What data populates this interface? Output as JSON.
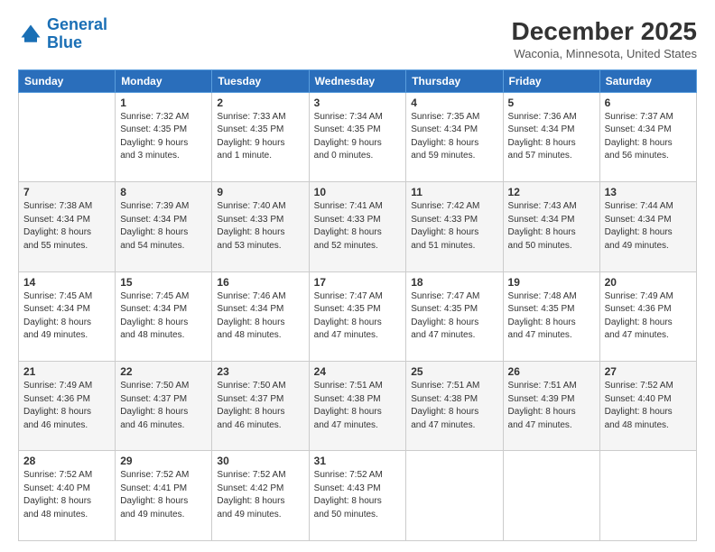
{
  "logo": {
    "line1": "General",
    "line2": "Blue"
  },
  "header": {
    "title": "December 2025",
    "subtitle": "Waconia, Minnesota, United States"
  },
  "calendar": {
    "days": [
      "Sunday",
      "Monday",
      "Tuesday",
      "Wednesday",
      "Thursday",
      "Friday",
      "Saturday"
    ],
    "weeks": [
      [
        {
          "day": "",
          "info": ""
        },
        {
          "day": "1",
          "info": "Sunrise: 7:32 AM\nSunset: 4:35 PM\nDaylight: 9 hours\nand 3 minutes."
        },
        {
          "day": "2",
          "info": "Sunrise: 7:33 AM\nSunset: 4:35 PM\nDaylight: 9 hours\nand 1 minute."
        },
        {
          "day": "3",
          "info": "Sunrise: 7:34 AM\nSunset: 4:35 PM\nDaylight: 9 hours\nand 0 minutes."
        },
        {
          "day": "4",
          "info": "Sunrise: 7:35 AM\nSunset: 4:34 PM\nDaylight: 8 hours\nand 59 minutes."
        },
        {
          "day": "5",
          "info": "Sunrise: 7:36 AM\nSunset: 4:34 PM\nDaylight: 8 hours\nand 57 minutes."
        },
        {
          "day": "6",
          "info": "Sunrise: 7:37 AM\nSunset: 4:34 PM\nDaylight: 8 hours\nand 56 minutes."
        }
      ],
      [
        {
          "day": "7",
          "info": "Sunrise: 7:38 AM\nSunset: 4:34 PM\nDaylight: 8 hours\nand 55 minutes."
        },
        {
          "day": "8",
          "info": "Sunrise: 7:39 AM\nSunset: 4:34 PM\nDaylight: 8 hours\nand 54 minutes."
        },
        {
          "day": "9",
          "info": "Sunrise: 7:40 AM\nSunset: 4:33 PM\nDaylight: 8 hours\nand 53 minutes."
        },
        {
          "day": "10",
          "info": "Sunrise: 7:41 AM\nSunset: 4:33 PM\nDaylight: 8 hours\nand 52 minutes."
        },
        {
          "day": "11",
          "info": "Sunrise: 7:42 AM\nSunset: 4:33 PM\nDaylight: 8 hours\nand 51 minutes."
        },
        {
          "day": "12",
          "info": "Sunrise: 7:43 AM\nSunset: 4:34 PM\nDaylight: 8 hours\nand 50 minutes."
        },
        {
          "day": "13",
          "info": "Sunrise: 7:44 AM\nSunset: 4:34 PM\nDaylight: 8 hours\nand 49 minutes."
        }
      ],
      [
        {
          "day": "14",
          "info": "Sunrise: 7:45 AM\nSunset: 4:34 PM\nDaylight: 8 hours\nand 49 minutes."
        },
        {
          "day": "15",
          "info": "Sunrise: 7:45 AM\nSunset: 4:34 PM\nDaylight: 8 hours\nand 48 minutes."
        },
        {
          "day": "16",
          "info": "Sunrise: 7:46 AM\nSunset: 4:34 PM\nDaylight: 8 hours\nand 48 minutes."
        },
        {
          "day": "17",
          "info": "Sunrise: 7:47 AM\nSunset: 4:35 PM\nDaylight: 8 hours\nand 47 minutes."
        },
        {
          "day": "18",
          "info": "Sunrise: 7:47 AM\nSunset: 4:35 PM\nDaylight: 8 hours\nand 47 minutes."
        },
        {
          "day": "19",
          "info": "Sunrise: 7:48 AM\nSunset: 4:35 PM\nDaylight: 8 hours\nand 47 minutes."
        },
        {
          "day": "20",
          "info": "Sunrise: 7:49 AM\nSunset: 4:36 PM\nDaylight: 8 hours\nand 47 minutes."
        }
      ],
      [
        {
          "day": "21",
          "info": "Sunrise: 7:49 AM\nSunset: 4:36 PM\nDaylight: 8 hours\nand 46 minutes."
        },
        {
          "day": "22",
          "info": "Sunrise: 7:50 AM\nSunset: 4:37 PM\nDaylight: 8 hours\nand 46 minutes."
        },
        {
          "day": "23",
          "info": "Sunrise: 7:50 AM\nSunset: 4:37 PM\nDaylight: 8 hours\nand 46 minutes."
        },
        {
          "day": "24",
          "info": "Sunrise: 7:51 AM\nSunset: 4:38 PM\nDaylight: 8 hours\nand 47 minutes."
        },
        {
          "day": "25",
          "info": "Sunrise: 7:51 AM\nSunset: 4:38 PM\nDaylight: 8 hours\nand 47 minutes."
        },
        {
          "day": "26",
          "info": "Sunrise: 7:51 AM\nSunset: 4:39 PM\nDaylight: 8 hours\nand 47 minutes."
        },
        {
          "day": "27",
          "info": "Sunrise: 7:52 AM\nSunset: 4:40 PM\nDaylight: 8 hours\nand 48 minutes."
        }
      ],
      [
        {
          "day": "28",
          "info": "Sunrise: 7:52 AM\nSunset: 4:40 PM\nDaylight: 8 hours\nand 48 minutes."
        },
        {
          "day": "29",
          "info": "Sunrise: 7:52 AM\nSunset: 4:41 PM\nDaylight: 8 hours\nand 49 minutes."
        },
        {
          "day": "30",
          "info": "Sunrise: 7:52 AM\nSunset: 4:42 PM\nDaylight: 8 hours\nand 49 minutes."
        },
        {
          "day": "31",
          "info": "Sunrise: 7:52 AM\nSunset: 4:43 PM\nDaylight: 8 hours\nand 50 minutes."
        },
        {
          "day": "",
          "info": ""
        },
        {
          "day": "",
          "info": ""
        },
        {
          "day": "",
          "info": ""
        }
      ]
    ]
  }
}
